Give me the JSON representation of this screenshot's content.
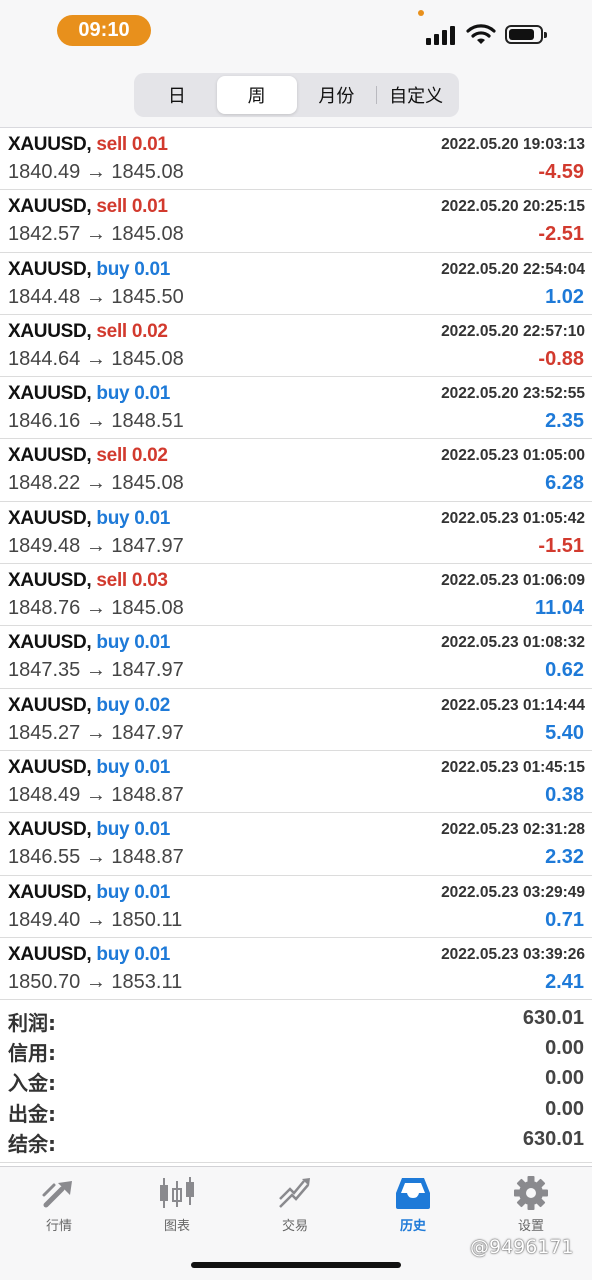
{
  "status_bar": {
    "time": "09:10"
  },
  "period_tabs": [
    {
      "label": "日",
      "active": false
    },
    {
      "label": "周",
      "active": true
    },
    {
      "label": "月份",
      "active": false
    },
    {
      "label": "自定义",
      "active": false
    }
  ],
  "trades": [
    {
      "symbol": "XAUUSD,",
      "side": "sell",
      "lots": "0.01",
      "datetime": "2022.05.20 19:03:13",
      "open": "1840.49",
      "close": "1845.08",
      "profit": "-4.59"
    },
    {
      "symbol": "XAUUSD,",
      "side": "sell",
      "lots": "0.01",
      "datetime": "2022.05.20 20:25:15",
      "open": "1842.57",
      "close": "1845.08",
      "profit": "-2.51"
    },
    {
      "symbol": "XAUUSD,",
      "side": "buy",
      "lots": "0.01",
      "datetime": "2022.05.20 22:54:04",
      "open": "1844.48",
      "close": "1845.50",
      "profit": "1.02"
    },
    {
      "symbol": "XAUUSD,",
      "side": "sell",
      "lots": "0.02",
      "datetime": "2022.05.20 22:57:10",
      "open": "1844.64",
      "close": "1845.08",
      "profit": "-0.88"
    },
    {
      "symbol": "XAUUSD,",
      "side": "buy",
      "lots": "0.01",
      "datetime": "2022.05.20 23:52:55",
      "open": "1846.16",
      "close": "1848.51",
      "profit": "2.35"
    },
    {
      "symbol": "XAUUSD,",
      "side": "sell",
      "lots": "0.02",
      "datetime": "2022.05.23 01:05:00",
      "open": "1848.22",
      "close": "1845.08",
      "profit": "6.28"
    },
    {
      "symbol": "XAUUSD,",
      "side": "buy",
      "lots": "0.01",
      "datetime": "2022.05.23 01:05:42",
      "open": "1849.48",
      "close": "1847.97",
      "profit": "-1.51"
    },
    {
      "symbol": "XAUUSD,",
      "side": "sell",
      "lots": "0.03",
      "datetime": "2022.05.23 01:06:09",
      "open": "1848.76",
      "close": "1845.08",
      "profit": "11.04"
    },
    {
      "symbol": "XAUUSD,",
      "side": "buy",
      "lots": "0.01",
      "datetime": "2022.05.23 01:08:32",
      "open": "1847.35",
      "close": "1847.97",
      "profit": "0.62"
    },
    {
      "symbol": "XAUUSD,",
      "side": "buy",
      "lots": "0.02",
      "datetime": "2022.05.23 01:14:44",
      "open": "1845.27",
      "close": "1847.97",
      "profit": "5.40"
    },
    {
      "symbol": "XAUUSD,",
      "side": "buy",
      "lots": "0.01",
      "datetime": "2022.05.23 01:45:15",
      "open": "1848.49",
      "close": "1848.87",
      "profit": "0.38"
    },
    {
      "symbol": "XAUUSD,",
      "side": "buy",
      "lots": "0.01",
      "datetime": "2022.05.23 02:31:28",
      "open": "1846.55",
      "close": "1848.87",
      "profit": "2.32"
    },
    {
      "symbol": "XAUUSD,",
      "side": "buy",
      "lots": "0.01",
      "datetime": "2022.05.23 03:29:49",
      "open": "1849.40",
      "close": "1850.11",
      "profit": "0.71"
    },
    {
      "symbol": "XAUUSD,",
      "side": "buy",
      "lots": "0.01",
      "datetime": "2022.05.23 03:39:26",
      "open": "1850.70",
      "close": "1853.11",
      "profit": "2.41"
    }
  ],
  "arrow": "→",
  "summary": [
    {
      "label": "利润:",
      "value": "630.01"
    },
    {
      "label": "信用:",
      "value": "0.00"
    },
    {
      "label": "入金:",
      "value": "0.00"
    },
    {
      "label": "出金:",
      "value": "0.00"
    },
    {
      "label": "结余:",
      "value": "630.01"
    }
  ],
  "tabbar": [
    {
      "label": "行情",
      "icon": "quotes-icon",
      "active": false
    },
    {
      "label": "图表",
      "icon": "candlestick-chart-icon",
      "active": false
    },
    {
      "label": "交易",
      "icon": "trade-icon",
      "active": false
    },
    {
      "label": "历史",
      "icon": "history-inbox-icon",
      "active": true
    },
    {
      "label": "设置",
      "icon": "gear-icon",
      "active": false
    }
  ],
  "watermark": "@9496171",
  "colors": {
    "sell": "#d23a2e",
    "buy": "#1e7ad8",
    "accent": "#1e7ad8",
    "time_pill": "#e8901c"
  }
}
